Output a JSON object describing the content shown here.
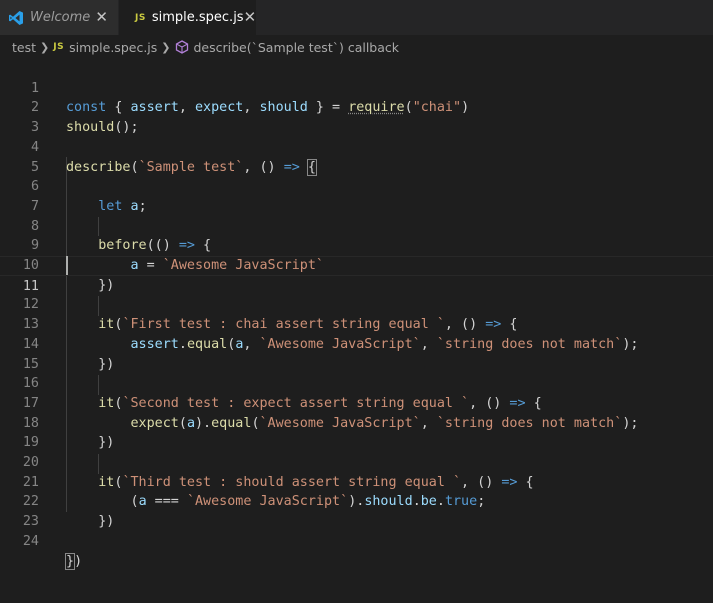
{
  "tabs": [
    {
      "icon": "vscode-icon",
      "label": "Welcome",
      "close": "✕",
      "active": false
    },
    {
      "icon": "JS",
      "label": "simple.spec.js",
      "close": "✕",
      "active": true
    }
  ],
  "breadcrumb": {
    "items": [
      "test",
      "simple.spec.js",
      "describe(`Sample test`) callback"
    ],
    "icons": [
      "",
      "JS",
      "symbol-method-icon"
    ]
  },
  "editor": {
    "current_line": 11,
    "line_numbers": [
      "1",
      "2",
      "3",
      "4",
      "5",
      "6",
      "7",
      "8",
      "9",
      "10",
      "11",
      "12",
      "13",
      "14",
      "15",
      "16",
      "17",
      "18",
      "19",
      "20",
      "21",
      "22",
      "23",
      "24"
    ]
  },
  "colors": {
    "keyword": "#569cd6",
    "variable": "#9cdcfe",
    "function": "#dcdcaa",
    "string": "#ce9178",
    "text": "#d4d4d4",
    "background": "#1e1e1e"
  },
  "code": {
    "l1": {
      "t1": "const",
      "t2": " { ",
      "t3": "assert",
      "t4": ", ",
      "t5": "expect",
      "t6": ", ",
      "t7": "should",
      "t8": " } = ",
      "t9": "require",
      "t10": "(",
      "t11": "\"chai\"",
      "t12": ")"
    },
    "l2": {
      "t1": "should",
      "t2": "();"
    },
    "l4": {
      "t1": "describe",
      "t2": "(",
      "t3": "`Sample test`",
      "t4": ", () ",
      "t5": "=>",
      "t6": " ",
      "t7": "{"
    },
    "l6": {
      "t1": "    ",
      "t2": "let",
      "t3": " ",
      "t4": "a",
      "t5": ";"
    },
    "l8": {
      "t1": "    ",
      "t2": "before",
      "t3": "(() ",
      "t4": "=>",
      "t5": " {"
    },
    "l9": {
      "t1": "        ",
      "t2": "a",
      "t3": " = ",
      "t4": "`Awesome JavaScript`"
    },
    "l10": {
      "t1": "    })"
    },
    "l12": {
      "t1": "    ",
      "t2": "it",
      "t3": "(",
      "t4": "`First test : chai assert string equal `",
      "t5": ", () ",
      "t6": "=>",
      "t7": " {"
    },
    "l13": {
      "t1": "        ",
      "t2": "assert",
      "t3": ".",
      "t4": "equal",
      "t5": "(",
      "t6": "a",
      "t7": ", ",
      "t8": "`Awesome JavaScript`",
      "t9": ", ",
      "t10": "`string does not match`",
      "t11": ");"
    },
    "l14": {
      "t1": "    })"
    },
    "l16": {
      "t1": "    ",
      "t2": "it",
      "t3": "(",
      "t4": "`Second test : expect assert string equal `",
      "t5": ", () ",
      "t6": "=>",
      "t7": " {"
    },
    "l17": {
      "t1": "        ",
      "t2": "expect",
      "t3": "(",
      "t4": "a",
      "t5": ").",
      "t6": "equal",
      "t7": "(",
      "t8": "`Awesome JavaScript`",
      "t9": ", ",
      "t10": "`string does not match`",
      "t11": ");"
    },
    "l18": {
      "t1": "    })"
    },
    "l20": {
      "t1": "    ",
      "t2": "it",
      "t3": "(",
      "t4": "`Third test : should assert string equal `",
      "t5": ", () ",
      "t6": "=>",
      "t7": " {"
    },
    "l21": {
      "t1": "        (",
      "t2": "a",
      "t3": " === ",
      "t4": "`Awesome JavaScript`",
      "t5": ").",
      "t6": "should",
      "t7": ".",
      "t8": "be",
      "t9": ".",
      "t10": "true",
      "t11": ";"
    },
    "l22": {
      "t1": "    })"
    },
    "l24": {
      "t1": "}",
      "t2": ")"
    }
  }
}
